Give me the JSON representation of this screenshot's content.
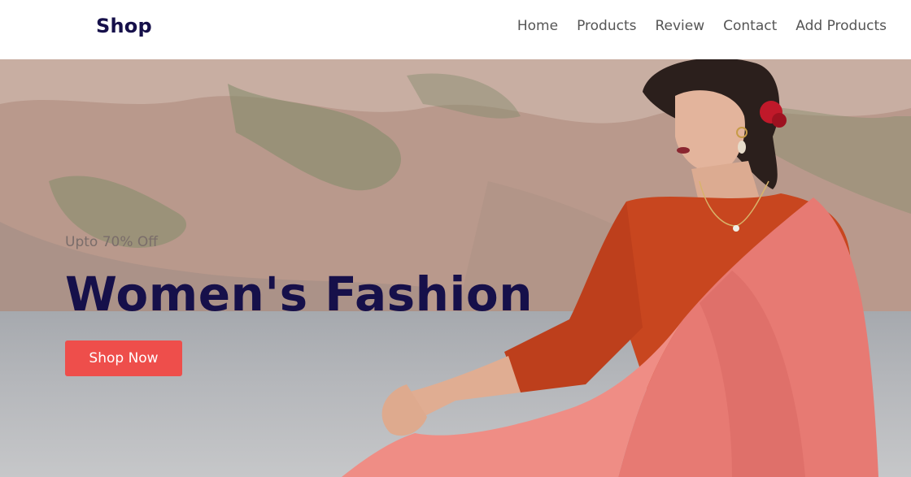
{
  "header": {
    "logo": "Shop",
    "nav": [
      {
        "label": "Home"
      },
      {
        "label": "Products"
      },
      {
        "label": "Review"
      },
      {
        "label": "Contact"
      },
      {
        "label": "Add Products"
      }
    ]
  },
  "hero": {
    "subtitle": "Upto 70% Off",
    "title": "Women's Fashion",
    "cta_label": "Shop Now"
  },
  "colors": {
    "brand_dark": "#16104a",
    "accent": "#ee4e4b",
    "nav_text": "#555555"
  }
}
